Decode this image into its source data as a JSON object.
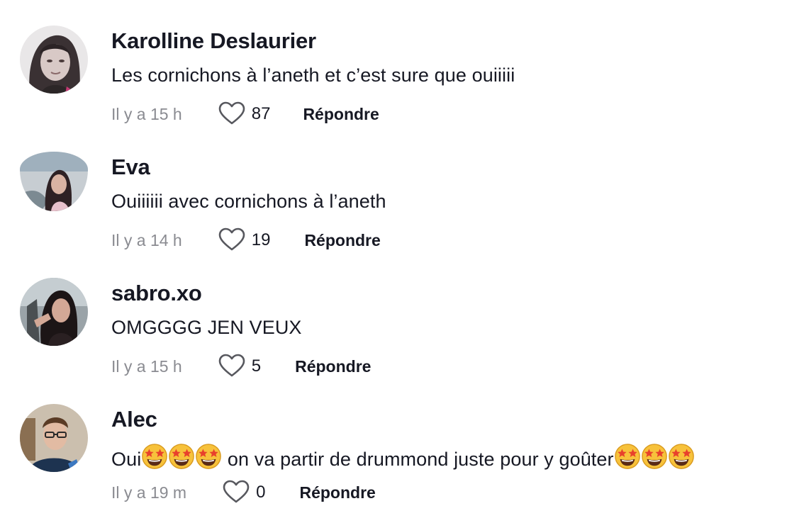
{
  "comments": [
    {
      "username": "Karolline Deslaurier",
      "text": "Les cornichons à l’aneth et c’est sure que ouiiiii",
      "time": "Il y a 15 h",
      "likes": "87",
      "reply_label": "Répondre"
    },
    {
      "username": "Eva",
      "text": "Ouiiiiii avec cornichons à l’aneth",
      "time": "Il y a 14 h",
      "likes": "19",
      "reply_label": "Répondre"
    },
    {
      "username": "sabro.xo",
      "text": "OMGGGG JEN VEUX",
      "time": "Il y a 15 h",
      "likes": "5",
      "reply_label": "Répondre"
    },
    {
      "username": "Alec",
      "text_before": "Oui",
      "text_middle": " on va partir de drummond juste pour y goûter",
      "emoji_name": "star-struck-emoji",
      "time": "Il y a 19 m",
      "likes": "0",
      "reply_label": "Répondre"
    }
  ],
  "icons": {
    "like": "heart-outline-icon"
  },
  "colors": {
    "text": "#161823",
    "meta": "#8a8b91",
    "background": "#ffffff"
  }
}
